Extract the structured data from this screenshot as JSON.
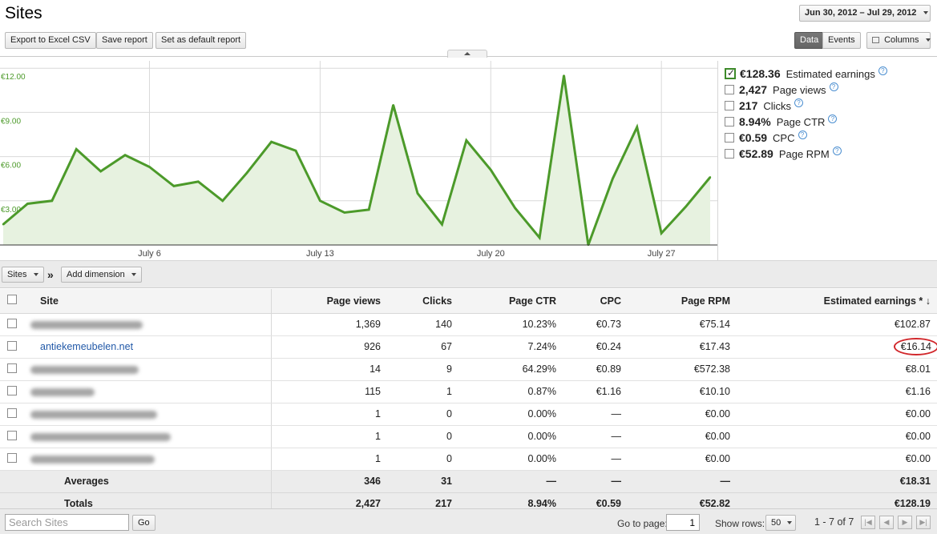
{
  "header": {
    "title": "Sites",
    "date_range": "Jun 30, 2012 – Jul 29, 2012",
    "export_label": "Export to Excel CSV",
    "save_label": "Save report",
    "default_label": "Set as default report",
    "view_data": "Data",
    "view_events": "Events",
    "columns_label": "Columns"
  },
  "metrics": [
    {
      "value": "€128.36",
      "label": "Estimated earnings",
      "checked": true
    },
    {
      "value": "2,427",
      "label": "Page views",
      "checked": false
    },
    {
      "value": "217",
      "label": "Clicks",
      "checked": false
    },
    {
      "value": "8.94%",
      "label": "Page CTR",
      "checked": false
    },
    {
      "value": "€0.59",
      "label": "CPC",
      "checked": false
    },
    {
      "value": "€52.89",
      "label": "Page RPM",
      "checked": false
    }
  ],
  "chart_data": {
    "type": "area",
    "series": [
      {
        "values": [
          1.4,
          2.8,
          3.0,
          6.5,
          5.0,
          6.1,
          5.3,
          4.0,
          4.3,
          3.0,
          4.9,
          7.0,
          6.4,
          3.0,
          2.2,
          2.4,
          9.5,
          3.5,
          1.4,
          7.1,
          5.1,
          2.5,
          0.5,
          11.5,
          0.0,
          4.5,
          8.0,
          0.8,
          2.6,
          4.6
        ]
      }
    ],
    "x": [
      "Jun 30",
      "Jul 1",
      "Jul 2",
      "Jul 3",
      "Jul 4",
      "Jul 5",
      "Jul 6",
      "Jul 7",
      "Jul 8",
      "Jul 9",
      "Jul 10",
      "Jul 11",
      "Jul 12",
      "Jul 13",
      "Jul 14",
      "Jul 15",
      "Jul 16",
      "Jul 17",
      "Jul 18",
      "Jul 19",
      "Jul 20",
      "Jul 21",
      "Jul 22",
      "Jul 23",
      "Jul 24",
      "Jul 25",
      "Jul 26",
      "Jul 27",
      "Jul 28",
      "Jul 29"
    ],
    "y_ticks": [
      "€12.00",
      "€9.00",
      "€6.00",
      "€3.00"
    ],
    "y_tick_values": [
      12,
      9,
      6,
      3
    ],
    "x_ticks": [
      "July 6",
      "July 13",
      "July 20",
      "July 27"
    ],
    "x_tick_values": [
      "Jul 6",
      "Jul 13",
      "Jul 20",
      "Jul 27"
    ],
    "ylim": [
      0,
      12.5
    ],
    "grid": true,
    "line_color": "#4c9a2a",
    "fill_color": "#e7f2e0"
  },
  "toolbar": {
    "dimension_label": "Sites",
    "separator": "»",
    "add_dimension_label": "Add dimension"
  },
  "table": {
    "columns": [
      "Site",
      "Page views",
      "Clicks",
      "Page CTR",
      "CPC",
      "Page RPM",
      "Estimated earnings * ↓"
    ],
    "rows": [
      {
        "site": "",
        "redacted": true,
        "blur_w": 140,
        "cells": [
          "1,369",
          "140",
          "10.23%",
          "€0.73",
          "€75.14",
          "€102.87"
        ]
      },
      {
        "site": "antiekemeubelen.net",
        "redacted": false,
        "blur_w": 0,
        "cells": [
          "926",
          "67",
          "7.24%",
          "€0.24",
          "€17.43",
          "€16.14"
        ]
      },
      {
        "site": "",
        "redacted": true,
        "blur_w": 135,
        "cells": [
          "14",
          "9",
          "64.29%",
          "€0.89",
          "€572.38",
          "€8.01"
        ]
      },
      {
        "site": "",
        "redacted": true,
        "blur_w": 80,
        "cells": [
          "115",
          "1",
          "0.87%",
          "€1.16",
          "€10.10",
          "€1.16"
        ]
      },
      {
        "site": "",
        "redacted": true,
        "blur_w": 158,
        "cells": [
          "1",
          "0",
          "0.00%",
          "—",
          "€0.00",
          "€0.00"
        ]
      },
      {
        "site": "",
        "redacted": true,
        "blur_w": 175,
        "cells": [
          "1",
          "0",
          "0.00%",
          "—",
          "€0.00",
          "€0.00"
        ]
      },
      {
        "site": "",
        "redacted": true,
        "blur_w": 155,
        "cells": [
          "1",
          "0",
          "0.00%",
          "—",
          "€0.00",
          "€0.00"
        ]
      }
    ],
    "averages": {
      "label": "Averages",
      "cells": [
        "346",
        "31",
        "—",
        "—",
        "—",
        "€18.31"
      ]
    },
    "totals": {
      "label": "Totals",
      "cells": [
        "2,427",
        "217",
        "8.94%",
        "€0.59",
        "€52.82",
        "€128.19"
      ]
    }
  },
  "footer": {
    "search_placeholder": "Search Sites",
    "go_label": "Go",
    "go_to_page_label": "Go to page:",
    "page_value": "1",
    "show_rows_label": "Show rows:",
    "rows_value": "50",
    "range_label": "1 - 7 of 7"
  }
}
